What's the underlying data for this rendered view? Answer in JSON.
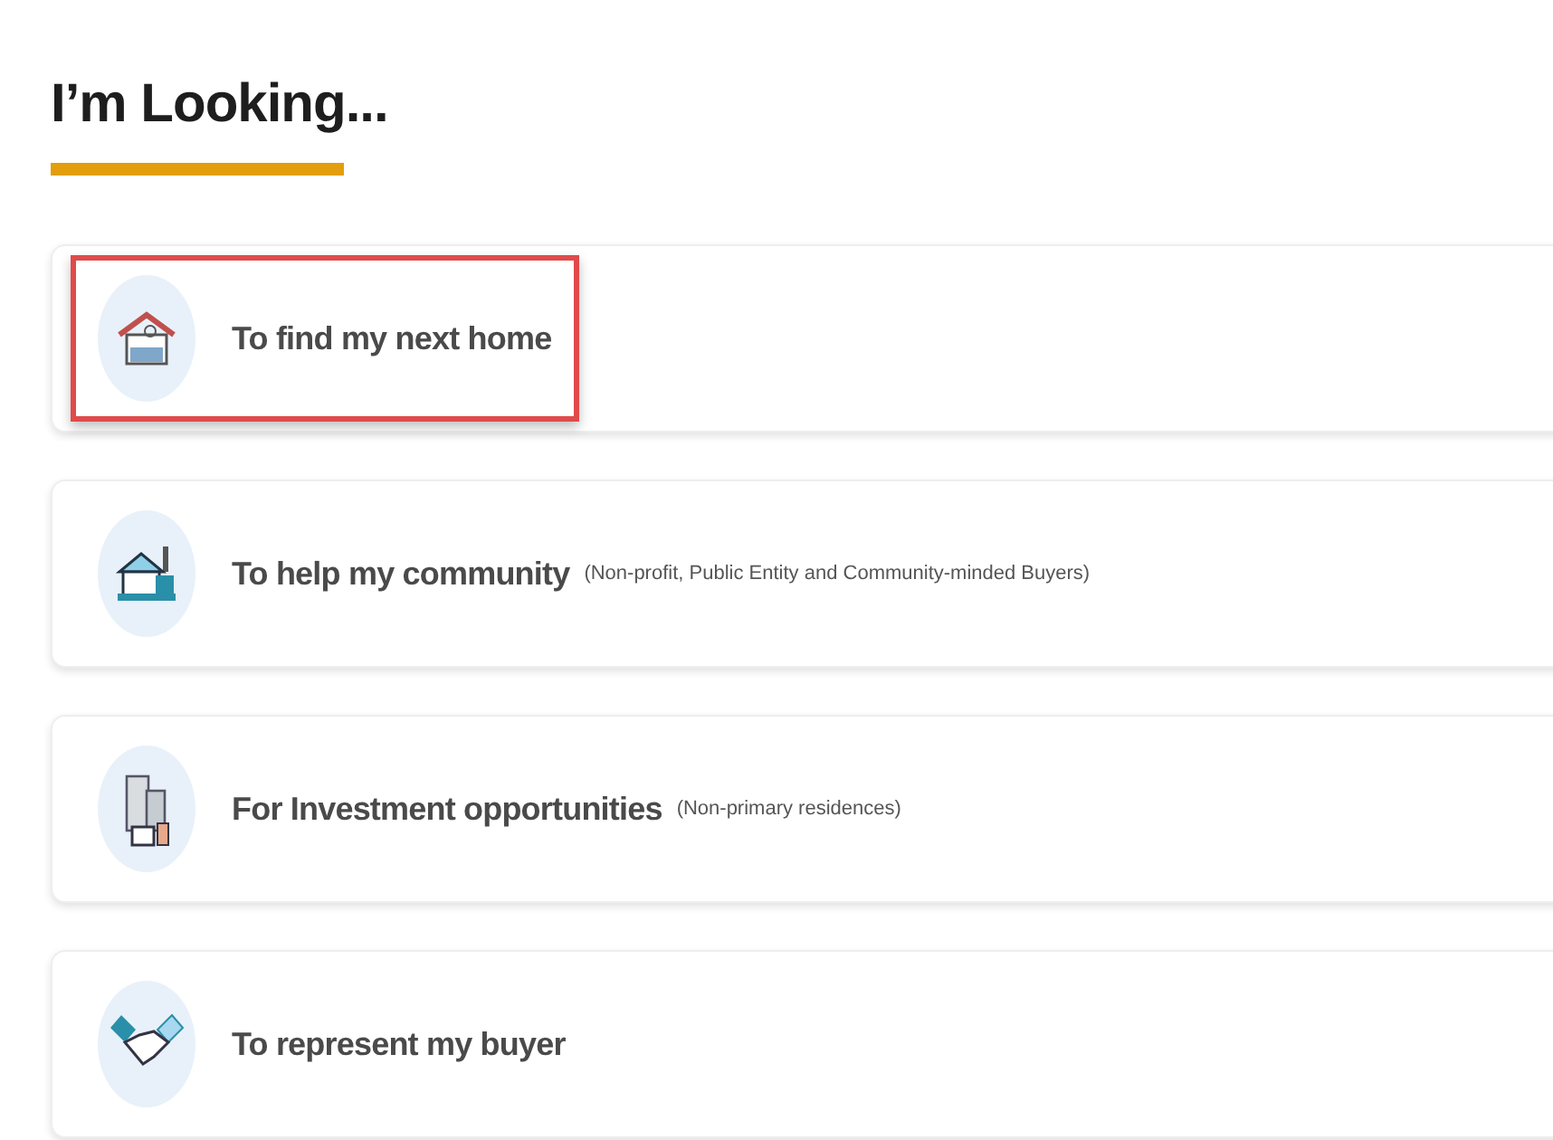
{
  "heading": "I’m Looking...",
  "options": [
    {
      "kind": "house",
      "label": "To find my next home",
      "highlighted": true
    },
    {
      "kind": "community",
      "label": "To help my community",
      "note": "(Non-profit, Public Entity and Community-minded Buyers)",
      "highlighted": false
    },
    {
      "kind": "buildings",
      "label": "For Investment opportunities",
      "note": "(Non-primary residences)",
      "highlighted": false
    },
    {
      "kind": "handshake",
      "label": "To represent my buyer",
      "highlighted": false
    }
  ]
}
